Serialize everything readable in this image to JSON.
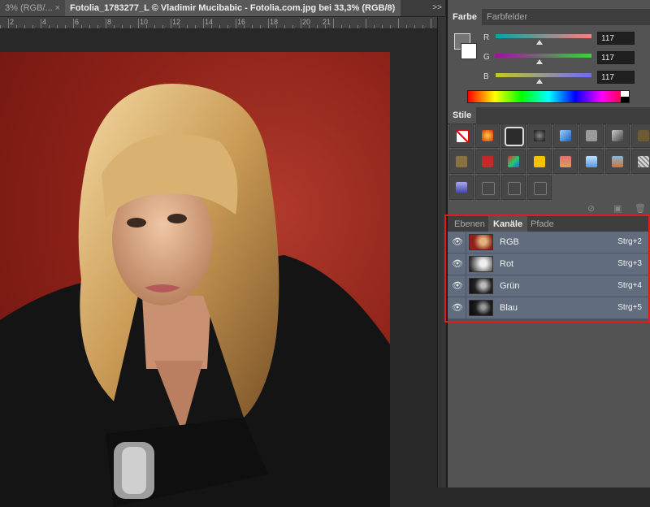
{
  "document_tabs": [
    {
      "label": "3% (RGB/...",
      "close": "×"
    },
    {
      "label": "Fotolia_1783277_L © Vladimir Mucibabic - Fotolia.com.jpg bei 33,3% (RGB/8)",
      "close": "×"
    }
  ],
  "tab_overflow": ">>",
  "ruler_numbers": [
    "2",
    "4",
    "6",
    "8",
    "10",
    "12",
    "14",
    "16",
    "18",
    "20",
    "21"
  ],
  "colors": {
    "app_bg": "#282828",
    "panel_bg": "#535353",
    "channel_row_bg": "#616d7e",
    "highlight_border": "#e01b1b",
    "foreground_color": "#757575",
    "background_color": "#ffffff"
  },
  "farbe_panel": {
    "tabs": [
      "Farbe",
      "Farbfelder"
    ],
    "active_tab": "Farbe",
    "sliders": [
      {
        "label": "R",
        "value": "117",
        "fraction": 0.46
      },
      {
        "label": "G",
        "value": "117",
        "fraction": 0.46
      },
      {
        "label": "B",
        "value": "117",
        "fraction": 0.46
      }
    ]
  },
  "stile_panel": {
    "tab": "Stile",
    "style_count": 24
  },
  "channels_panel": {
    "tabs": [
      "Ebenen",
      "Kanäle",
      "Pfade"
    ],
    "active_tab": "Kanäle",
    "channels": [
      {
        "name": "RGB",
        "shortcut": "Strg+2",
        "visible_icon": "eye-icon"
      },
      {
        "name": "Rot",
        "shortcut": "Strg+3",
        "visible_icon": "eye-icon"
      },
      {
        "name": "Grün",
        "shortcut": "Strg+4",
        "visible_icon": "eye-icon"
      },
      {
        "name": "Blau",
        "shortcut": "Strg+5",
        "visible_icon": "eye-icon"
      }
    ]
  }
}
